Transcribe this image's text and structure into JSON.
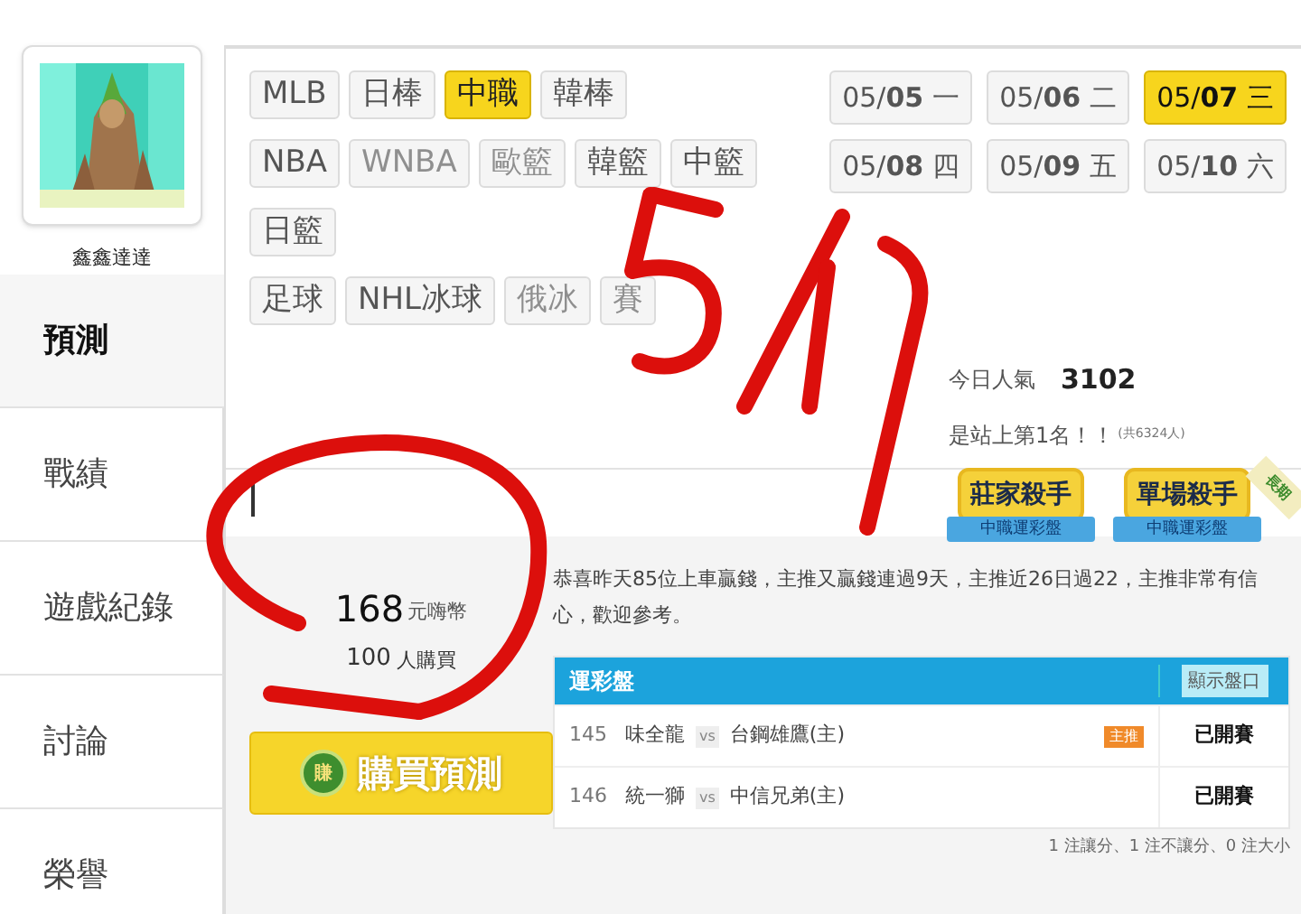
{
  "profile": {
    "name": "鑫鑫達達"
  },
  "nav": [
    {
      "label": "預測",
      "selected": true
    },
    {
      "label": "戰績",
      "selected": false
    },
    {
      "label": "遊戲紀錄",
      "selected": false
    },
    {
      "label": "討論",
      "selected": false
    },
    {
      "label": "榮譽",
      "selected": false
    }
  ],
  "sports": [
    [
      {
        "label": "MLB",
        "selected": false,
        "disabled": false
      },
      {
        "label": "日棒",
        "selected": false,
        "disabled": false
      },
      {
        "label": "中職",
        "selected": true,
        "disabled": false
      },
      {
        "label": "韓棒",
        "selected": false,
        "disabled": false
      }
    ],
    [
      {
        "label": "NBA",
        "selected": false,
        "disabled": false
      },
      {
        "label": "WNBA",
        "selected": false,
        "disabled": true
      },
      {
        "label": "歐籃",
        "selected": false,
        "disabled": true
      },
      {
        "label": "韓籃",
        "selected": false,
        "disabled": false
      },
      {
        "label": "中籃",
        "selected": false,
        "disabled": false
      }
    ],
    [
      {
        "label": "日籃",
        "selected": false,
        "disabled": false
      }
    ],
    [
      {
        "label": "足球",
        "selected": false,
        "disabled": false
      },
      {
        "label": "NHL冰球",
        "selected": false,
        "disabled": false
      },
      {
        "label": "俄冰",
        "selected": false,
        "disabled": true
      },
      {
        "label": "賽",
        "selected": false,
        "disabled": true
      }
    ]
  ],
  "dates": [
    {
      "prefix": "05/",
      "day": "05",
      "weekday": "一",
      "selected": false
    },
    {
      "prefix": "05/",
      "day": "06",
      "weekday": "二",
      "selected": false
    },
    {
      "prefix": "05/",
      "day": "07",
      "weekday": "三",
      "selected": true
    },
    {
      "prefix": "05/",
      "day": "08",
      "weekday": "四",
      "selected": false
    },
    {
      "prefix": "05/",
      "day": "09",
      "weekday": "五",
      "selected": false
    },
    {
      "prefix": "05/",
      "day": "10",
      "weekday": "六",
      "selected": false
    }
  ],
  "stats": {
    "popularity_label": "今日人氣",
    "popularity": "3102",
    "rank_text": "是站上第1名！！",
    "rank_total": "(共6324人)"
  },
  "badges": [
    {
      "title": "莊家殺手",
      "subtitle": "中職運彩盤"
    },
    {
      "title": "單場殺手",
      "subtitle": "中職運彩盤"
    }
  ],
  "ribbon": "長期",
  "price": {
    "amount": "168",
    "unit": "元嗨幣",
    "buyers": "100",
    "buyers_unit": "人購買",
    "coin": "賺",
    "button": "購買預測"
  },
  "message": "恭喜昨天85位上車贏錢，主推又贏錢連過9天，主推近26日過22，主推非常有信心，歡迎參考。",
  "table": {
    "title": "運彩盤",
    "toggle": "顯示盤口",
    "rows": [
      {
        "number": "145",
        "away": "味全龍",
        "vs": "vs",
        "home": "台鋼雄鷹(主)",
        "tag": "主推",
        "status": "已開賽"
      },
      {
        "number": "146",
        "away": "統一獅",
        "vs": "vs",
        "home": "中信兄弟(主)",
        "status": "已開賽"
      }
    ],
    "summary": "1 注讓分、1 注不讓分、0 注大小"
  }
}
